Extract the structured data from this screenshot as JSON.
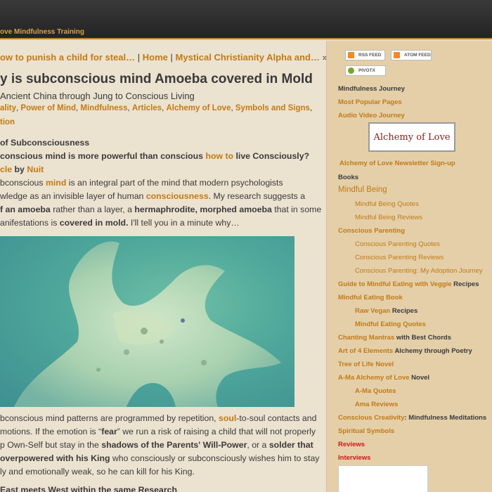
{
  "topbar": {
    "nav_text": "ove Mindfulness Training"
  },
  "breadcrumb": {
    "items": [
      "ow to punish a child for steal…",
      "Home",
      "Mystical Christianity Alpha and…"
    ],
    "sep": "|",
    "end": "»"
  },
  "article": {
    "title": "y is subconscious mind Amoeba covered in Mold",
    "subtitle": "Ancient China through Jung to Conscious Living",
    "categories": [
      "ality",
      "Power of Mind",
      "Mindfulness",
      "Articles",
      "Alchemy of Love",
      "Symbols and Signs"
    ],
    "categories_tail": "tion",
    "section_heading": "of Subconsciousness",
    "question_pre": "conscious mind is more powerful than conscious",
    "question_link": "how to",
    "question_post": "live Consciously?",
    "byline_pre": "cle",
    "byline_by": "by",
    "byline_author": "Nuit",
    "p1_l1_a": "bconscious",
    "p1_l1_link": "mind",
    "p1_l1_b": "is an integral part of the mind that modern psychologists",
    "p1_l2_a": "wledge as an invisible layer of human",
    "p1_l2_link": "consciousness",
    "p1_l2_b": ". My research suggests a",
    "p1_l3_bold1": "f an amoeba",
    "p1_l3_a": "rather than a layer, a",
    "p1_l3_bold2": "hermaphrodite, morphed amoeba",
    "p1_l3_b": "that in some",
    "p1_l4_a": "anifestations is",
    "p1_l4_bold": "covered in mold.",
    "p1_l4_b": "I'll tell you in a minute why…",
    "p2_l1_a": "bconscious mind patterns are programmed by repetition,",
    "p2_l1_link": "soul",
    "p2_l1_b": "-to-soul contacts and",
    "p2_l2_a": "motions. If the emotion is “",
    "p2_l2_bold": "fear",
    "p2_l2_b": "” we run a risk of raising a child that will not properly",
    "p2_l3_a": "p Own-Self but stay in the",
    "p2_l3_bold1": "shadows of the Parents' Will-Power",
    "p2_l3_b": ", or a",
    "p2_l3_bold2": "solder that",
    "p2_l4_bold": "overpowered with his King",
    "p2_l4_a": "who consciously or subconsciously wishes him to stay",
    "p2_l5": "ly and emotionally weak, so he can kill for his King.",
    "next_heading": "East meets West within the same Research"
  },
  "sidebar": {
    "rss_label": "RSS FEED",
    "atom_label": "ATOM FEED",
    "pivotx_label": "PIVOTX",
    "logo_text": "Alchemy of Love",
    "items": {
      "mindfulness_journey": "Mindfulness Journey",
      "most_popular": "Most Popular Pages",
      "audio_video": "Audio Video Journey",
      "newsletter": "Alchemy of Love Newsletter Sign-up",
      "books": "Books",
      "mindful_being": "Mindful Being",
      "mb_quotes": "Mindful Being Quotes",
      "mb_reviews": "Mindful Being Reviews",
      "conscious_parenting": "Conscious Parenting",
      "cp_quotes": "Conscious Parenting Quotes",
      "cp_reviews": "Conscious Parenting Reviews",
      "cp_adoption": "Conscious Parenting: My Adoption Journey",
      "guide_link": "Guide to Mindful Eating with Veggie",
      "guide_tail": "Recipes",
      "mindful_eating_book": "Mindful Eating Book",
      "raw_vegan_link": "Raw Vegan",
      "raw_vegan_tail": "Recipes",
      "mindful_eating_quotes": "Mindful Eating Quotes",
      "chanting_link": "Chanting Mantras",
      "chanting_tail": "with Best Chords",
      "art_link": "Art of 4 Elements",
      "art_tail": "Alchemy through Poetry",
      "tree_of_life": "Tree of Life Novel",
      "ama_link": "A-Ma Alchemy of Love",
      "ama_tail": "Novel",
      "ama_quotes": "A-Ma Quotes",
      "ama_reviews": "Ama Reviews",
      "creativity_link": "Conscious Creativity",
      "creativity_tail": ": Mindfulness Meditations",
      "spiritual_symbols": "Spiritual Symbols",
      "reviews": "Reviews",
      "interviews": "Interviews"
    }
  },
  "colors": {
    "accent": "#c27a14",
    "red": "#d01515",
    "sidebar_bg": "#e4cfa9",
    "main_bg": "#ece2d0"
  }
}
